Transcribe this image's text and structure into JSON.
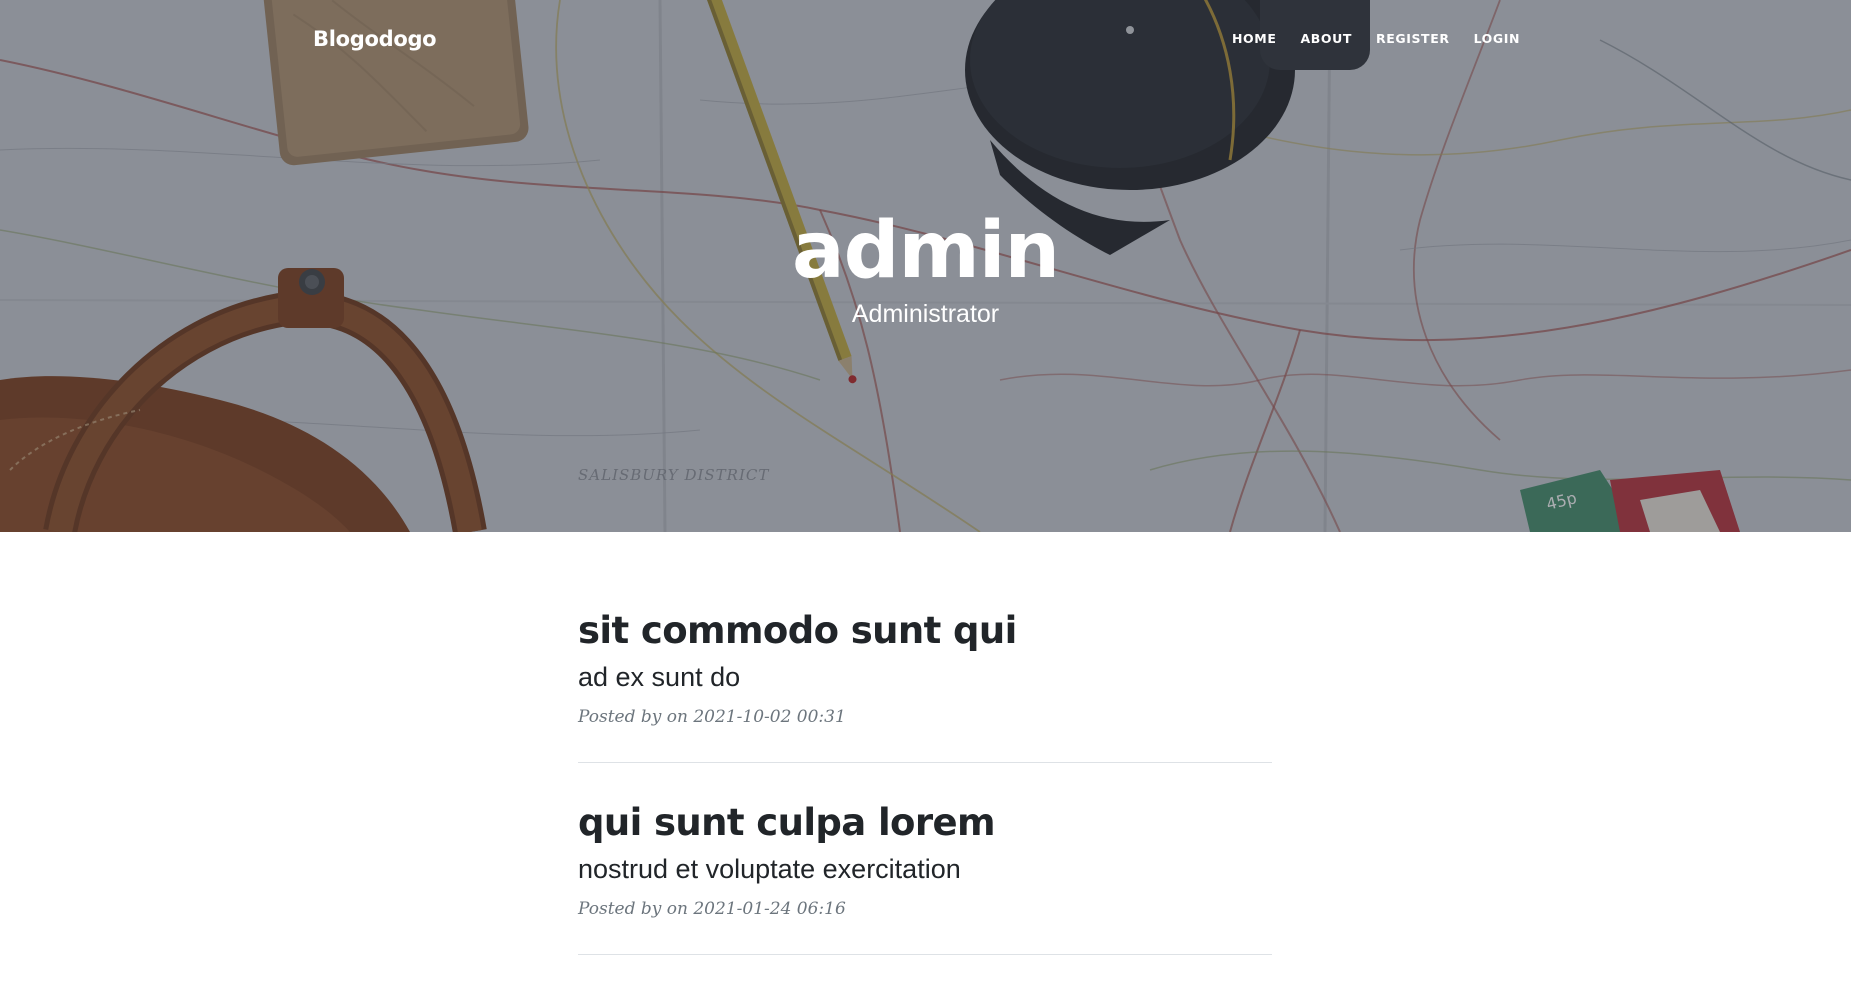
{
  "navbar": {
    "brand": "Blogodogo",
    "links": [
      {
        "label": "HOME"
      },
      {
        "label": "ABOUT"
      },
      {
        "label": "REGISTER"
      },
      {
        "label": "LOGIN"
      }
    ]
  },
  "hero": {
    "title": "admin",
    "subtitle": "Administrator",
    "background_image": "map-camera-bag-pencil-photo",
    "overlay_color": "#373c46"
  },
  "posts": [
    {
      "title": "sit commodo sunt qui",
      "subtitle": "ad ex sunt do",
      "meta": "Posted by on 2021-10-02 00:31"
    },
    {
      "title": "qui sunt culpa lorem",
      "subtitle": "nostrud et voluptate exercitation",
      "meta": "Posted by on 2021-01-24 06:16"
    }
  ],
  "colors": {
    "text_dark": "#212529",
    "text_muted": "#6c757d",
    "divider": "#dee2e6"
  }
}
